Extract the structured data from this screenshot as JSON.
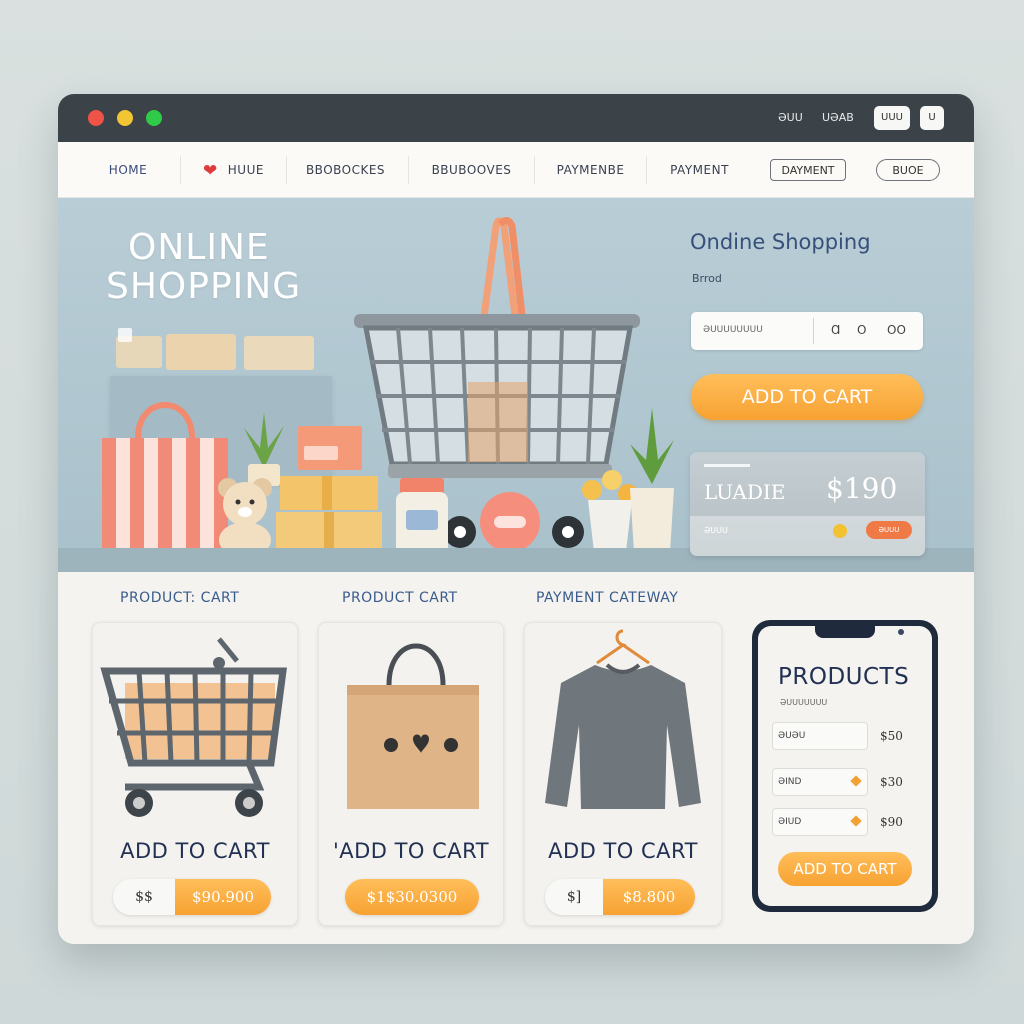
{
  "titlebar": {
    "controls": [
      "close",
      "minimize",
      "maximize"
    ],
    "right_text": [
      "ƏUU",
      "UƏAB"
    ],
    "right_pills": [
      "UUU",
      "U"
    ]
  },
  "nav": {
    "items": [
      "HOME",
      "HUUE",
      "BBOBOCKES",
      "BBUBOOVES",
      "PAYMENBE",
      "PAYMENT",
      "DAYMENT"
    ],
    "boxed": "BUOE"
  },
  "hero": {
    "title_line1": "ONLINE",
    "title_line2": "SHOPPING",
    "subtitle": "Ondine Shopping",
    "small_text": "Brrod",
    "input_value": "ƏUUUUUUUU",
    "input_buttons": [
      "Ɑ",
      "O",
      "OO"
    ],
    "add_to_cart": "ADD TO CART",
    "price_card": {
      "label": "LUADIE",
      "price": "$190",
      "small": "ƏUUU",
      "button": "ƏUUU"
    }
  },
  "sections": {
    "labels": [
      "PRODUCT: CART",
      "PRODUCT CART",
      "PAYMENT CATEWAY"
    ]
  },
  "cards": [
    {
      "title": "ADD TO CART",
      "price_left": "$$",
      "price_right": "$90.900",
      "icon": "shopping-cart-icon"
    },
    {
      "title": "'ADD TO CART",
      "price_left": "",
      "price_right": "$1$30.0300",
      "icon": "shopping-bag-icon"
    },
    {
      "title": "ADD TO CART",
      "price_left": "$]",
      "price_right": "$8.800",
      "icon": "sweater-icon"
    }
  ],
  "phone": {
    "title": "PRODUCTS",
    "subtitle": "ƏUUUUUUU",
    "rows": [
      {
        "name": "ƏUƏU",
        "price": "$50"
      },
      {
        "name": "ƏIND",
        "price": "$30"
      },
      {
        "name": "ƏIUD",
        "price": "$90"
      }
    ],
    "add_to_cart": "ADD TO CART"
  },
  "colors": {
    "accent_orange": "#f7a232",
    "navy_text": "#223054",
    "hero_bg": "#b9cdd6",
    "titlebar": "#3b4248"
  }
}
